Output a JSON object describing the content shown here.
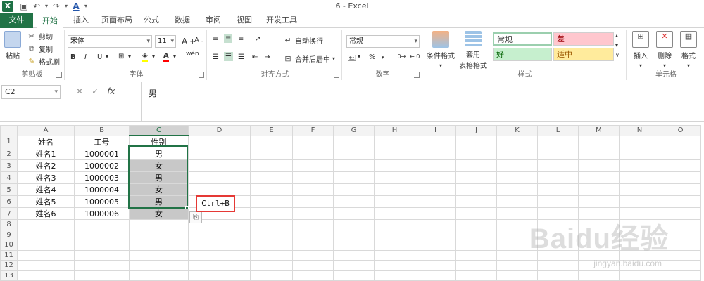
{
  "window": {
    "title": "6 - Excel"
  },
  "quick_access": {
    "save_icon": "save-icon",
    "undo_icon": "undo-icon",
    "redo_icon": "redo-icon",
    "font_color_icon": "font-color-icon"
  },
  "tabs": [
    {
      "label": "文件"
    },
    {
      "label": "开始"
    },
    {
      "label": "插入"
    },
    {
      "label": "页面布局"
    },
    {
      "label": "公式"
    },
    {
      "label": "数据"
    },
    {
      "label": "审阅"
    },
    {
      "label": "视图"
    },
    {
      "label": "开发工具"
    }
  ],
  "ribbon": {
    "clipboard": {
      "paste": "粘贴",
      "cut": "剪切",
      "copy": "复制",
      "format_painter": "格式刷",
      "label": "剪贴板"
    },
    "font": {
      "name": "宋体",
      "size": "11",
      "label": "字体",
      "bold": "B",
      "italic": "I",
      "underline": "U",
      "wen": "wén"
    },
    "alignment": {
      "wrap": "自动换行",
      "merge": "合并后居中",
      "label": "对齐方式"
    },
    "number": {
      "format": "常规",
      "label": "数字",
      "percent": "%",
      "comma": ","
    },
    "styles": {
      "cond_format": "条件格式",
      "table_format_1": "套用",
      "table_format_2": "表格格式",
      "normal": "常规",
      "bad": "差",
      "good": "好",
      "neutral": "适中",
      "label": "样式"
    },
    "cells": {
      "insert": "插入",
      "delete": "删除",
      "format": "格式",
      "label": "单元格"
    }
  },
  "formula_bar": {
    "name_box": "C2",
    "cancel": "✕",
    "enter": "✓",
    "fx": "fx",
    "content": "男"
  },
  "sheet": {
    "columns": [
      "A",
      "B",
      "C",
      "D",
      "E",
      "F",
      "G",
      "H",
      "I",
      "J",
      "K",
      "L",
      "M",
      "N",
      "O"
    ],
    "rows": [
      [
        "姓名",
        "工号",
        "性别"
      ],
      [
        "姓名1",
        "1000001",
        "男"
      ],
      [
        "姓名2",
        "1000002",
        "女"
      ],
      [
        "姓名3",
        "1000003",
        "男"
      ],
      [
        "姓名4",
        "1000004",
        "女"
      ],
      [
        "姓名5",
        "1000005",
        "男"
      ],
      [
        "姓名6",
        "1000006",
        "女"
      ],
      [],
      [],
      [],
      [],
      [],
      [],
      []
    ]
  },
  "annotation": {
    "text": "Ctrl+B"
  },
  "watermark": {
    "main": "Baidu经验",
    "sub": "jingyan.baidu.com"
  },
  "colors": {
    "accent": "#217346",
    "bad_bg": "#ffc7ce",
    "good_bg": "#c6efce",
    "neutral_bg": "#ffeb9c",
    "annotation_border": "#e53935"
  }
}
